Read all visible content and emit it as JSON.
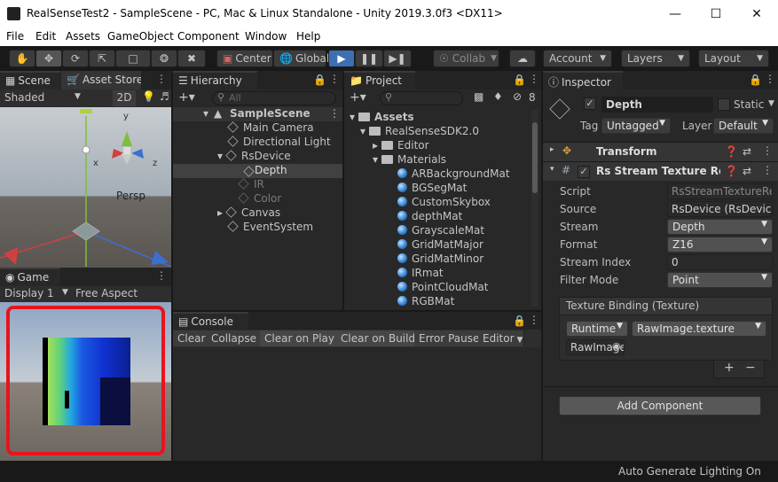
{
  "window": {
    "title": "RealSenseTest2 - SampleScene - PC, Mac & Linux Standalone - Unity 2019.3.0f3 <DX11>"
  },
  "menu": [
    "File",
    "Edit",
    "Assets",
    "GameObject",
    "Component",
    "Window",
    "Help"
  ],
  "toolbar": {
    "center": "Center",
    "global": "Global",
    "collab": "Collab",
    "account": "Account",
    "layers": "Layers",
    "layout": "Layout"
  },
  "scene": {
    "tab": "Scene",
    "tab2": "Asset Store",
    "shading": "Shaded",
    "mode2d": "2D",
    "persp": "Persp",
    "axis_x": "x",
    "axis_y": "y",
    "axis_z": "z"
  },
  "game": {
    "tab": "Game",
    "display": "Display 1",
    "aspect": "Free Aspect"
  },
  "hierarchy": {
    "tab": "Hierarchy",
    "search": "All",
    "items": [
      "SampleScene",
      "Main Camera",
      "Directional Light",
      "RsDevice",
      "Depth",
      "IR",
      "Color",
      "Canvas",
      "EventSystem"
    ]
  },
  "project": {
    "tab": "Project",
    "count": "8",
    "items": [
      "Assets",
      "RealSenseSDK2.0",
      "Editor",
      "Materials",
      "ARBackgroundMat",
      "BGSegMat",
      "CustomSkybox",
      "depthMat",
      "GrayscaleMat",
      "GridMatMajor",
      "GridMatMinor",
      "IRmat",
      "PointCloudMat",
      "RGBMat"
    ]
  },
  "console": {
    "tab": "Console",
    "buttons": [
      "Clear",
      "Collapse",
      "Clear on Play",
      "Clear on Build",
      "Error Pause",
      "Editor"
    ]
  },
  "inspector": {
    "tab": "Inspector",
    "name": "Depth",
    "static": "Static",
    "tag_label": "Tag",
    "tag": "Untagged",
    "layer_label": "Layer",
    "layer": "Default",
    "transform": "Transform",
    "component": "Rs Stream Texture Renderer",
    "fields": [
      {
        "label": "Script",
        "value": "RsStreamTextureRenderer"
      },
      {
        "label": "Source",
        "value": "RsDevice (RsDevice)"
      },
      {
        "label": "Stream",
        "value": "Depth"
      },
      {
        "label": "Format",
        "value": "Z16"
      },
      {
        "label": "Stream Index",
        "value": "0"
      },
      {
        "label": "Filter Mode",
        "value": "Point"
      }
    ],
    "binding_title": "Texture Binding (Texture)",
    "runtime": "Runtime",
    "binding_fn": "RawImage.texture",
    "rawimage": "RawImage",
    "plus": "+",
    "minus": "−",
    "add_component": "Add Component"
  },
  "status": {
    "text": "Auto Generate Lighting On"
  }
}
